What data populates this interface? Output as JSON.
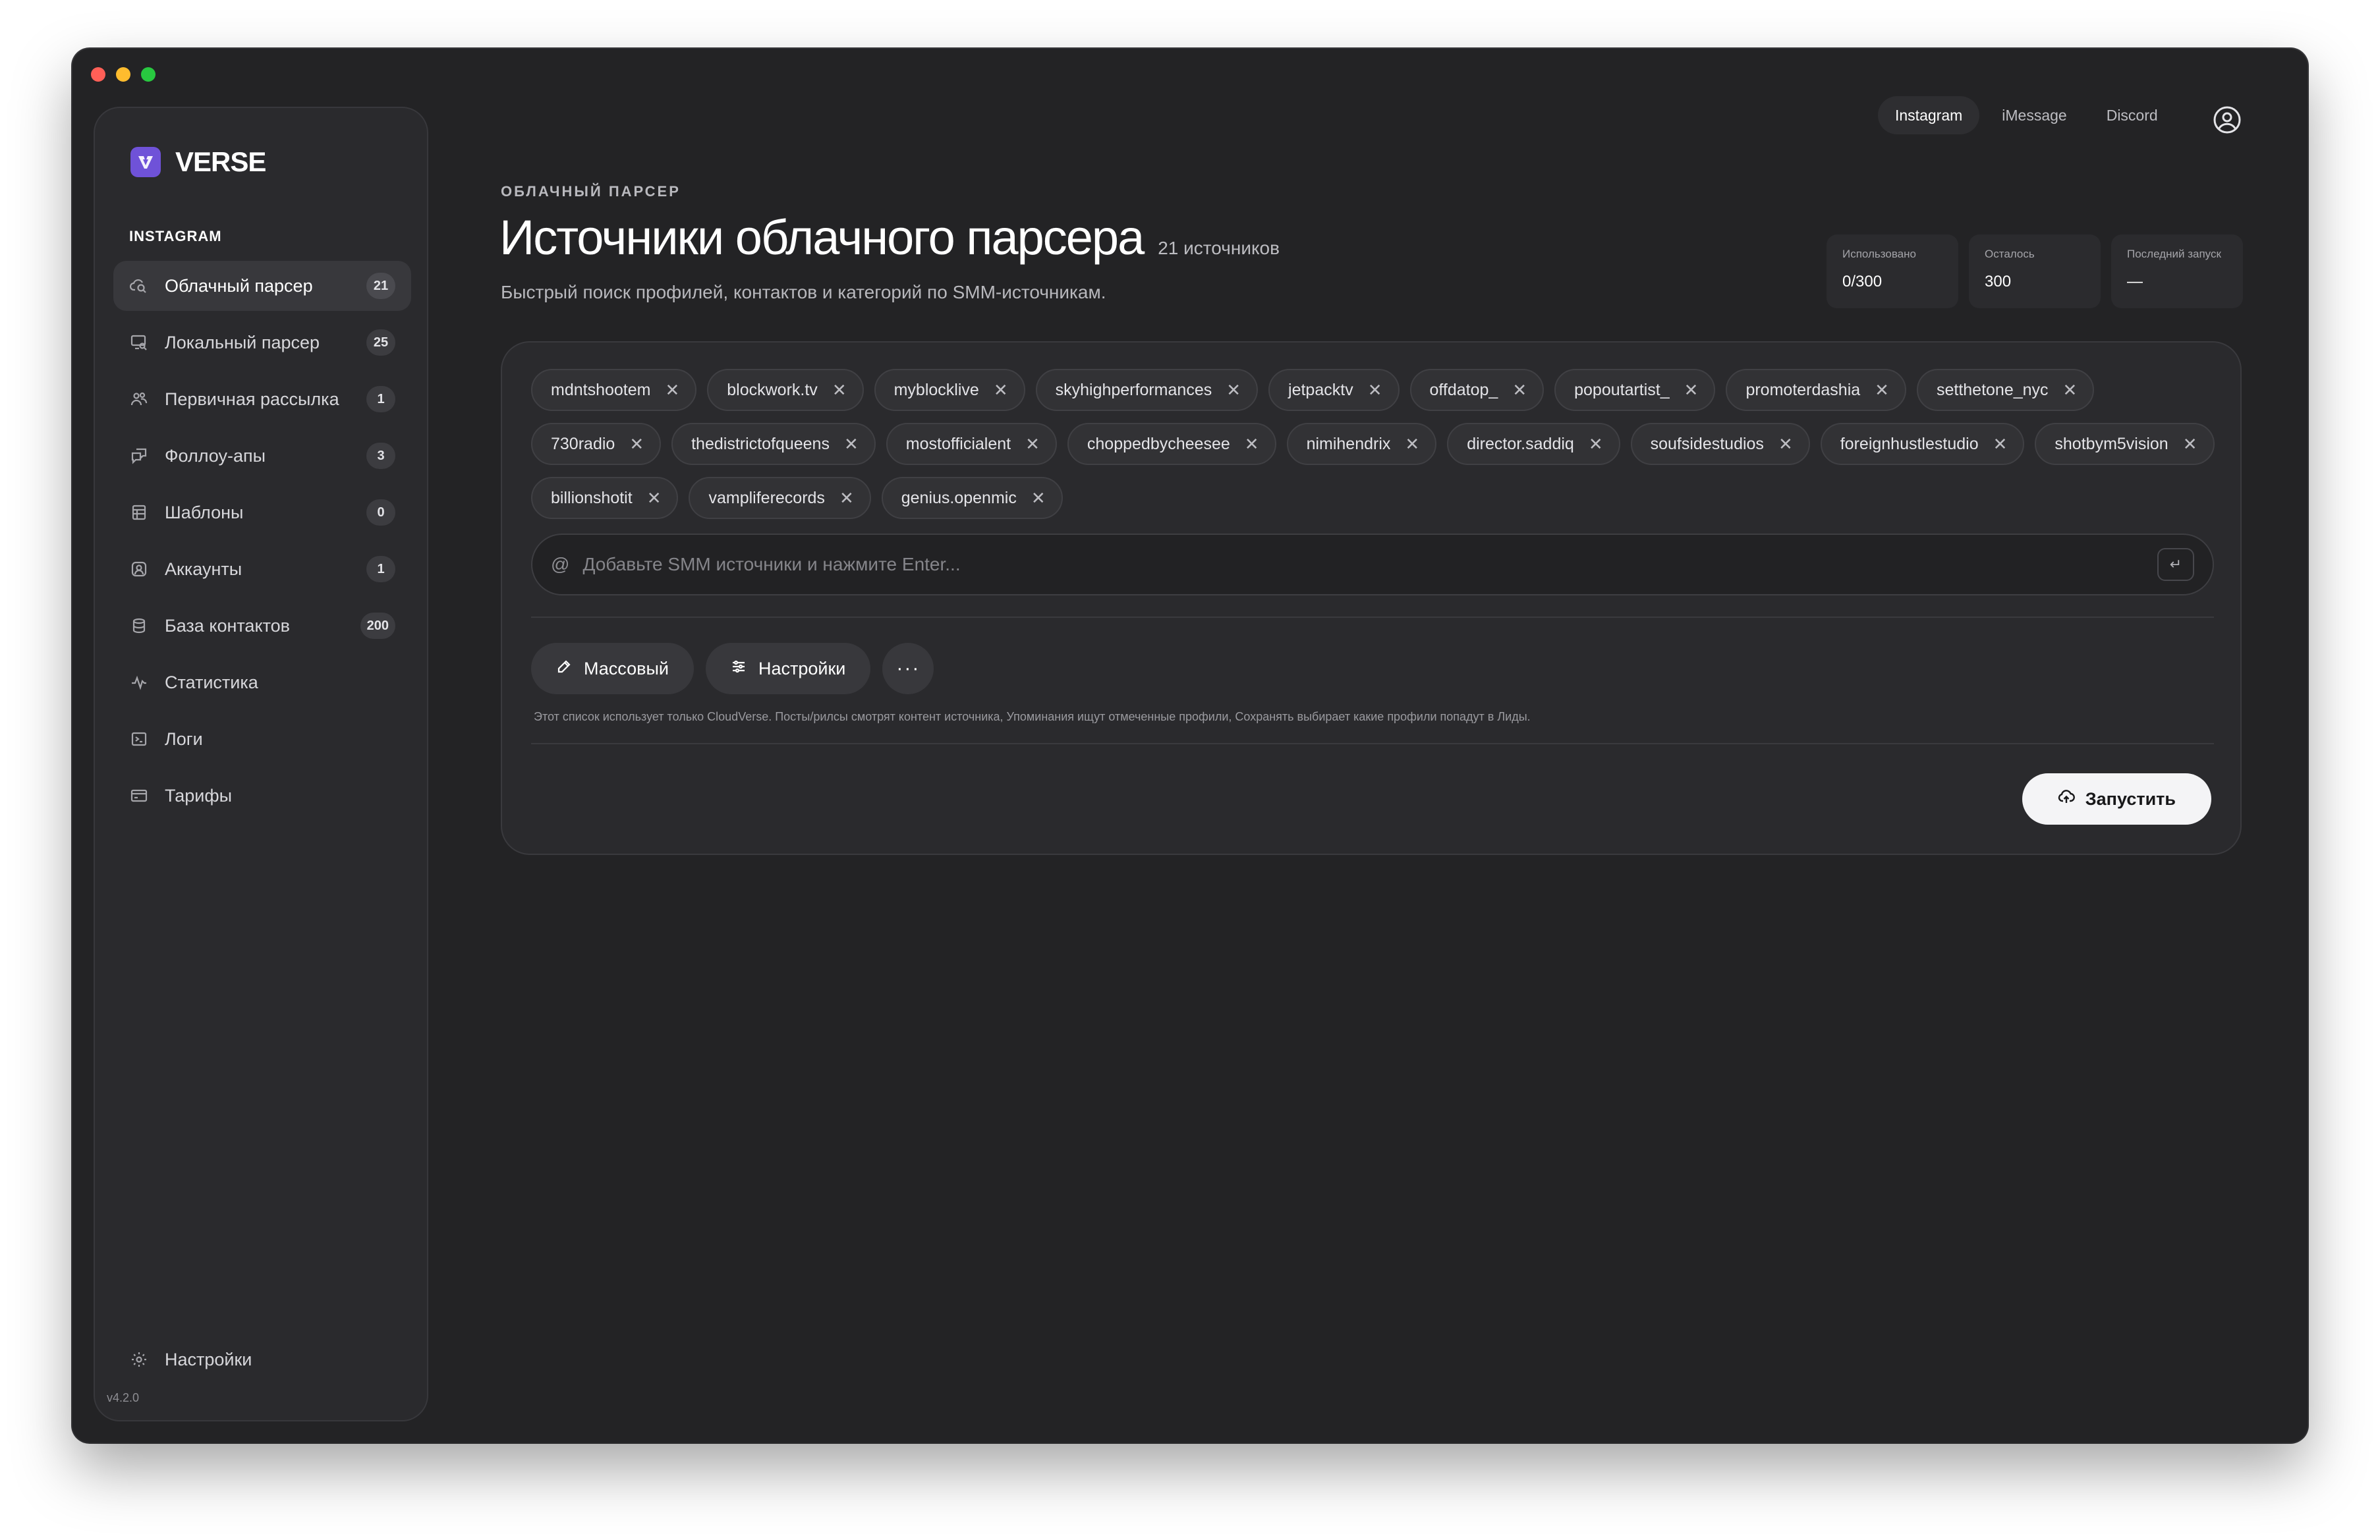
{
  "app": {
    "brand": "VERSE",
    "version": "v4.2.0"
  },
  "topnav": {
    "tabs": [
      {
        "label": "Instagram",
        "active": true
      },
      {
        "label": "iMessage",
        "active": false
      },
      {
        "label": "Discord",
        "active": false
      }
    ],
    "account_icon": "user-circle-icon"
  },
  "sidebar": {
    "section_label": "INSTAGRAM",
    "items": [
      {
        "label": "Облачный парсер",
        "badge": "21",
        "icon": "cloud-search-icon",
        "active": true
      },
      {
        "label": "Локальный парсер",
        "badge": "25",
        "icon": "monitor-search-icon",
        "active": false
      },
      {
        "label": "Первичная рассылка",
        "badge": "1",
        "icon": "users-icon",
        "active": false
      },
      {
        "label": "Фоллоу-апы",
        "badge": "3",
        "icon": "messages-icon",
        "active": false
      },
      {
        "label": "Шаблоны",
        "badge": "0",
        "icon": "template-icon",
        "active": false
      },
      {
        "label": "Аккаунты",
        "badge": "1",
        "icon": "account-icon",
        "active": false
      },
      {
        "label": "База контактов",
        "badge": "200",
        "icon": "database-icon",
        "active": false
      },
      {
        "label": "Статистика",
        "badge": "",
        "icon": "activity-icon",
        "active": false
      },
      {
        "label": "Логи",
        "badge": "",
        "icon": "terminal-icon",
        "active": false
      },
      {
        "label": "Тарифы",
        "badge": "",
        "icon": "credit-card-icon",
        "active": false
      }
    ],
    "settings_label": "Настройки"
  },
  "header": {
    "eyebrow": "ОБЛАЧНЫЙ ПАРСЕР",
    "title": "Источники облачного парсера",
    "count": "21 источников",
    "subtitle": "Быстрый поиск профилей, контактов и категорий по SMM-источникам."
  },
  "stats": [
    {
      "label": "Использовано",
      "value": "0/300"
    },
    {
      "label": "Осталось",
      "value": "300"
    },
    {
      "label": "Последний запуск",
      "value": "—"
    }
  ],
  "sources": [
    "mdntshootem",
    "blockwork.tv",
    "myblocklive",
    "skyhighperformances",
    "jetpacktv",
    "offdatop_",
    "popoutartist_",
    "promoterdashia",
    "setthetone_nyc",
    "730radio",
    "thedistrictofqueens",
    "mostofficialent",
    "choppedbycheesee",
    "nimihendrix",
    "director.saddiq",
    "soufsidestudios",
    "foreignhustlestudio",
    "shotbym5vision",
    "billionshotit",
    "vampliferecords",
    "genius.openmic"
  ],
  "input": {
    "placeholder": "Добавьте SMM источники и нажмите Enter...",
    "value": "",
    "enter_hint": "↵"
  },
  "actions": {
    "bulk_label": "Массовый",
    "settings_label": "Настройки",
    "more_label": "···"
  },
  "note": "Этот список использует только CloudVerse. Посты/рилсы смотрят контент источника, Упоминания ищут отмеченные профили, Сохранять выбирает какие профили попадут в Лиды.",
  "run_label": "Запустить",
  "colors": {
    "accent": "#6f52d8",
    "background": "#232325",
    "panel": "#2a2a2d"
  }
}
